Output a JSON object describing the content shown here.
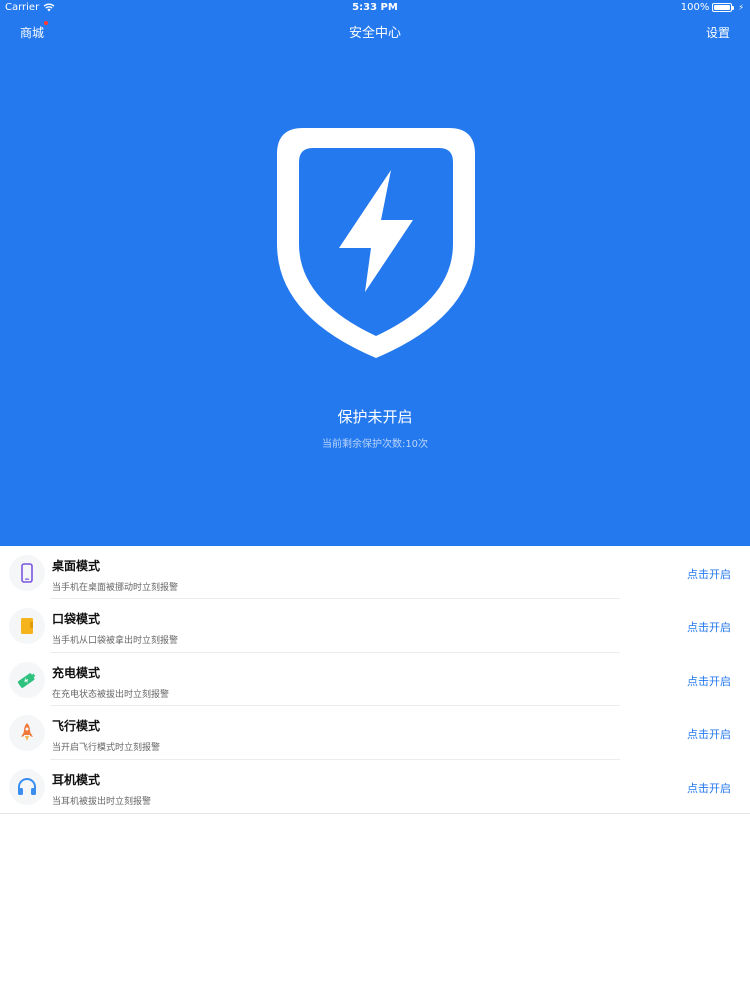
{
  "statusbar": {
    "carrier": "Carrier",
    "time": "5:33 PM",
    "battery": "100%"
  },
  "navbar": {
    "left": "商城",
    "title": "安全中心",
    "right": "设置"
  },
  "protection": {
    "title": "保护未开启",
    "subtitle": "当前剩余保护次数:10次"
  },
  "colors": {
    "primary": "#2479ee",
    "dot": "#ff3b30"
  },
  "modes": [
    {
      "icon": "phone-icon",
      "title": "桌面模式",
      "desc": "当手机在桌面被挪动时立刻报警",
      "action": "点击开启"
    },
    {
      "icon": "pocket-icon",
      "title": "口袋模式",
      "desc": "当手机从口袋被拿出时立刻报警",
      "action": "点击开启"
    },
    {
      "icon": "charging-icon",
      "title": "充电模式",
      "desc": "在充电状态被拔出时立刻报警",
      "action": "点击开启"
    },
    {
      "icon": "airplane-icon",
      "title": "飞行模式",
      "desc": "当开启飞行模式时立刻报警",
      "action": "点击开启"
    },
    {
      "icon": "headphones-icon",
      "title": "耳机模式",
      "desc": "当耳机被拔出时立刻报警",
      "action": "点击开启"
    }
  ]
}
